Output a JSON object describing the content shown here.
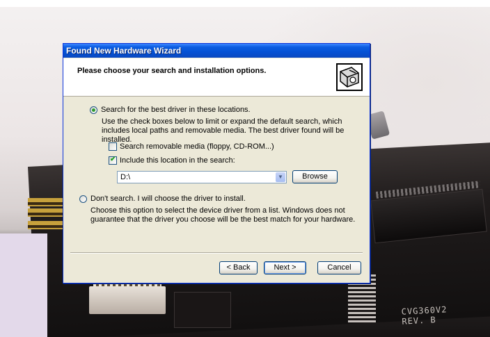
{
  "window": {
    "title": "Found New Hardware Wizard",
    "header_title": "Please choose your search and installation options."
  },
  "options": {
    "search": {
      "label": "Search for the best driver in these locations.",
      "selected": true,
      "description": "Use the check boxes below to limit or expand the default search, which includes local paths and removable media. The best driver found will be installed."
    },
    "removable_media": {
      "label": "Search removable media (floppy, CD-ROM...)",
      "checked": false
    },
    "include_location": {
      "label": "Include this location in the search:",
      "checked": true
    },
    "location_value": "D:\\",
    "browse_label": "Browse",
    "dont_search": {
      "label": "Don't search. I will choose the driver to install.",
      "selected": false,
      "description": "Choose this option to select the device driver from a list.  Windows does not guarantee that the driver you choose will be the best match for your hardware."
    }
  },
  "buttons": {
    "back": "< Back",
    "next": "Next >",
    "cancel": "Cancel"
  },
  "background": {
    "silkscreen": [
      "CVG360V2",
      "REV. B"
    ]
  },
  "colors": {
    "titlebar": "#0a5ce0",
    "dialog_face": "#ece9d8",
    "accent_green": "#2f9a2f"
  }
}
